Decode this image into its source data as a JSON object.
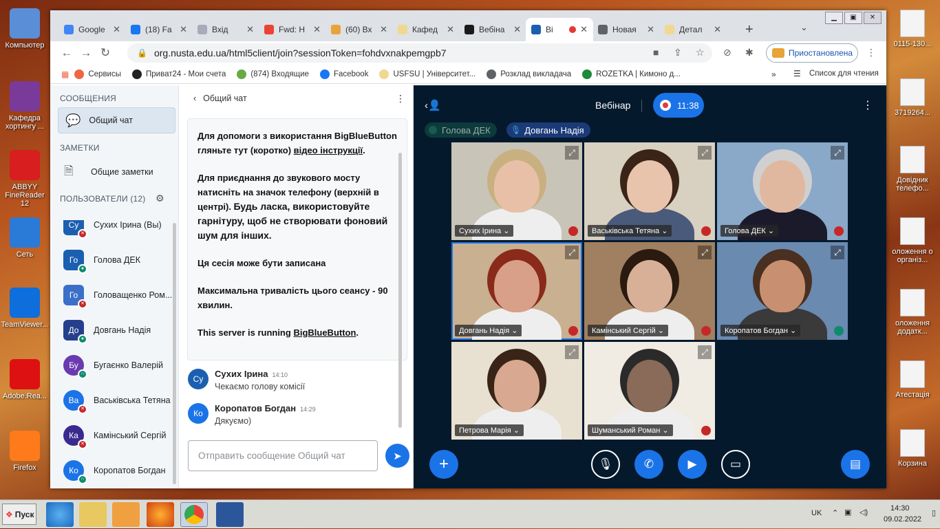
{
  "desktop": {
    "left_icons": [
      {
        "label": "Компьютер",
        "icon": "computer-icon",
        "color": "#5a8fd8"
      },
      {
        "label": "Кафедра хортингу ...",
        "icon": "winrar-icon",
        "color": "#7a3a9a"
      },
      {
        "label": "ABBYY FineReader 12",
        "icon": "abbyy-icon",
        "color": "#d81e1e"
      },
      {
        "label": "Сеть",
        "icon": "network-icon",
        "color": "#2a7ad8"
      },
      {
        "label": "TeamViewer...",
        "icon": "teamviewer-icon",
        "color": "#0e6edb"
      },
      {
        "label": "Adobe.Rea...",
        "icon": "adobe-icon",
        "color": "#d11"
      },
      {
        "label": "Firefox",
        "icon": "firefox-icon",
        "color": "#ff7a1a"
      }
    ],
    "right_icons": [
      {
        "label": "0115-130..."
      },
      {
        "label": "3719264..."
      },
      {
        "label": "Довідник телефо..."
      },
      {
        "label": "оложення о організ..."
      },
      {
        "label": "оложення додатк..."
      },
      {
        "label": "Атестація"
      },
      {
        "label": "Корзина"
      }
    ]
  },
  "browser": {
    "tabs": [
      {
        "label": "Google",
        "color": "#4285f4"
      },
      {
        "label": "(18) Fa",
        "color": "#1877f2"
      },
      {
        "label": "Вхід",
        "color": "#aab"
      },
      {
        "label": "Fwd: H",
        "color": "#ea4335"
      },
      {
        "label": "(60) Вх",
        "color": "#e8a33a"
      },
      {
        "label": "Кафед",
        "color": "#f0d890"
      },
      {
        "label": "Вебіна",
        "color": "#1a1a1a"
      },
      {
        "label": "Bi",
        "color": "#1b5fb0",
        "active": true
      },
      {
        "label": "Новая",
        "color": "#5f6368"
      },
      {
        "label": "Детал",
        "color": "#f0d890"
      }
    ],
    "url": "org.nusta.edu.ua/html5client/join?sessionToken=fohdvxnakpemgpb7",
    "profile_label": "Приостановлена",
    "bookmarks": [
      {
        "label": "Сервисы",
        "color": "#e64"
      },
      {
        "label": "Приват24 - Мои счета",
        "color": "#222"
      },
      {
        "label": "(874) Входящие",
        "color": "#6a4"
      },
      {
        "label": "Facebook",
        "color": "#1877f2"
      },
      {
        "label": "USFSU | Університет...",
        "color": "#f0d890"
      },
      {
        "label": "Розклад викладача",
        "color": "#5f6368"
      },
      {
        "label": "ROZETKA | Кимоно д...",
        "color": "#1b8a3a"
      }
    ],
    "reading_list": "Список для чтения"
  },
  "sidebar": {
    "messages_title": "СООБЩЕНИЯ",
    "public_chat": "Общий чат",
    "notes_title": "ЗАМЕТКИ",
    "shared_notes": "Общие заметки",
    "users_title": "ПОЛЬЗОВАТЕЛИ (12)",
    "users": [
      {
        "initials": "Су",
        "name": "Сухих Ірина (Вы)",
        "color": "#1b5fb0",
        "status": "muted",
        "round": false
      },
      {
        "initials": "Го",
        "name": "Голова ДЕК",
        "color": "#1b5fb0",
        "status": "mic",
        "round": false
      },
      {
        "initials": "Го",
        "name": "Головащенко Ром...",
        "color": "#3a70c8",
        "status": "muted",
        "round": false
      },
      {
        "initials": "До",
        "name": "Довгань Надія",
        "color": "#253f8c",
        "status": "mic",
        "round": false
      },
      {
        "initials": "Бу",
        "name": "Бугаєнко Валерій",
        "color": "#6a3ab0",
        "status": "listen",
        "round": true
      },
      {
        "initials": "Ва",
        "name": "Васьківська Тетяна",
        "color": "#1b73e8",
        "status": "muted",
        "round": true
      },
      {
        "initials": "Ка",
        "name": "Камінський Сергій",
        "color": "#3a2a90",
        "status": "muted",
        "round": true
      },
      {
        "initials": "Ко",
        "name": "Коропатов Богдан",
        "color": "#1b73e8",
        "status": "listen",
        "round": true
      }
    ]
  },
  "chat": {
    "title": "Общий чат",
    "welcome": {
      "p1_a": "Для допомоги з використання BigBlueButton гляньте тут (коротко) ",
      "p1_link": "відео інструкції",
      "p1_b": ".",
      "p2_a": "Для приєднання до звукового мосту натисніть на значок телефону (верхній в центрі). ",
      "p2_b": "Будь ласка, використовуйте гарнітуру, щоб не створювати фоновий шум для інших.",
      "p3": "Ця сесія може бути записана",
      "p4": "Максимальна тривалість цього сеансу - 90 хвилин.",
      "p5_a": "This server is running ",
      "p5_link": "BigBlueButton",
      "p5_b": "."
    },
    "messages": [
      {
        "initials": "Су",
        "name": "Сухих Ірина",
        "time": "14:10",
        "text": "Чекаємо голову комісії",
        "color": "#1b5fb0"
      },
      {
        "initials": "Ко",
        "name": "Коропатов Богдан",
        "time": "14:29",
        "text": "Дякуємо)",
        "color": "#1b73e8"
      }
    ],
    "input_placeholder": "Отправить сообщение Общий чат"
  },
  "video": {
    "title": "Вебінар",
    "record_time": "11:38",
    "talkers": [
      "Голова ДЕК",
      "Довгань Надія"
    ],
    "tiles": [
      {
        "name": "Сухих Ірина",
        "status": "muted",
        "bg": "#c9c4b8",
        "skin": "#e8c0a8",
        "hair": "#c9b080"
      },
      {
        "name": "Васьківська Тетяна",
        "status": "muted",
        "bg": "#d8d0c0",
        "skin": "#e9c4ac",
        "hair": "#3a2418"
      },
      {
        "name": "Голова ДЕК",
        "status": "muted",
        "bg": "#8aa8c8",
        "skin": "#e0b8a0",
        "hair": "#d0d0d0"
      },
      {
        "name": "Довгань Надія",
        "status": "muted",
        "bg": "#c8b090",
        "skin": "#d8a088",
        "hair": "#8a2a1a"
      },
      {
        "name": "Камінський Сергій",
        "status": "muted",
        "bg": "#a08060",
        "skin": "#d8b098",
        "hair": "#2a1a10"
      },
      {
        "name": "Коропатов Богдан",
        "status": "listen",
        "bg": "#6a8ab0",
        "skin": "#c89070",
        "hair": "#4a3020"
      },
      {
        "name": "Петрова Марія",
        "status": "none",
        "bg": "#e8e0d0",
        "skin": "#d8a890",
        "hair": "#3a2418"
      },
      {
        "name": "Шуманський Роман",
        "status": "muted",
        "bg": "#f0ece4",
        "skin": "#8a6a58",
        "hair": "#2a2a2a"
      }
    ]
  },
  "taskbar": {
    "start_label": "Пуск",
    "lang": "UK",
    "time": "14:30",
    "date": "09.02.2022"
  }
}
